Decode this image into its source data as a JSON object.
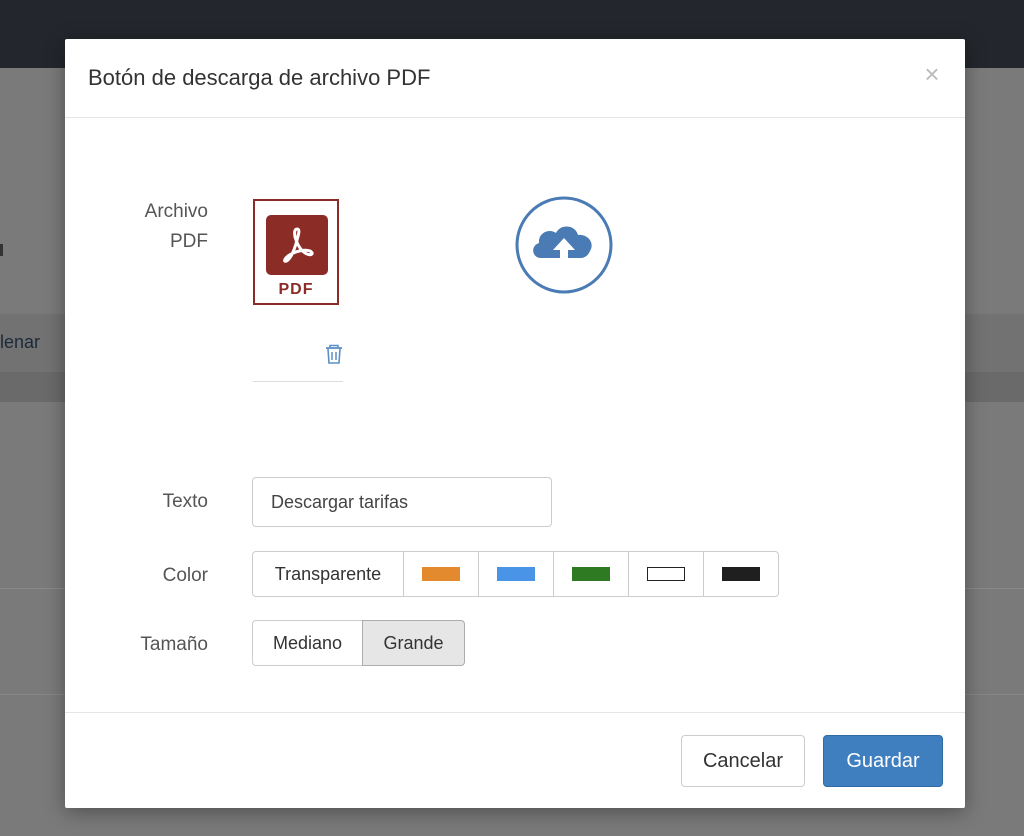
{
  "background": {
    "partial_text": "lenar"
  },
  "modal": {
    "title": "Botón de descarga de archivo PDF",
    "close_glyph": "×",
    "fields": {
      "archivo_label_line1": "Archivo",
      "archivo_label_line2": "PDF",
      "pdf_thumb_text": "PDF",
      "texto_label": "Texto",
      "texto_value": "Descargar tarifas",
      "color_label": "Color",
      "tamano_label": "Tamaño"
    },
    "color_options": {
      "transparent_label": "Transparente",
      "swatches": [
        "#e38a2e",
        "#4a94e8",
        "#2e7a23",
        "#ffffff",
        "#1f1f1f"
      ]
    },
    "size_options": {
      "mediano": "Mediano",
      "grande": "Grande",
      "selected": "Grande"
    },
    "footer": {
      "cancel_label": "Cancelar",
      "save_label": "Guardar"
    }
  },
  "colors": {
    "primary": "#3f7fbf",
    "pdf_red": "#8b2c26",
    "upload_blue": "#4a7bb4",
    "trash_blue": "#5a8fc7"
  }
}
